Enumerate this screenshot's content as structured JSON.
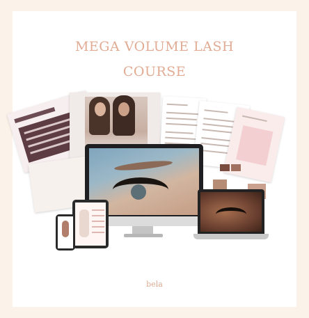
{
  "title_line1": "MEGA VOLUME LASH",
  "title_line2": "COURSE",
  "logo_text": "bela",
  "colors": {
    "background": "#fbf3ea",
    "card": "#ffffff",
    "title": "#e2ab93"
  },
  "icons": [
    "monitor-icon",
    "laptop-icon",
    "tablet-icon",
    "phone-icon"
  ]
}
